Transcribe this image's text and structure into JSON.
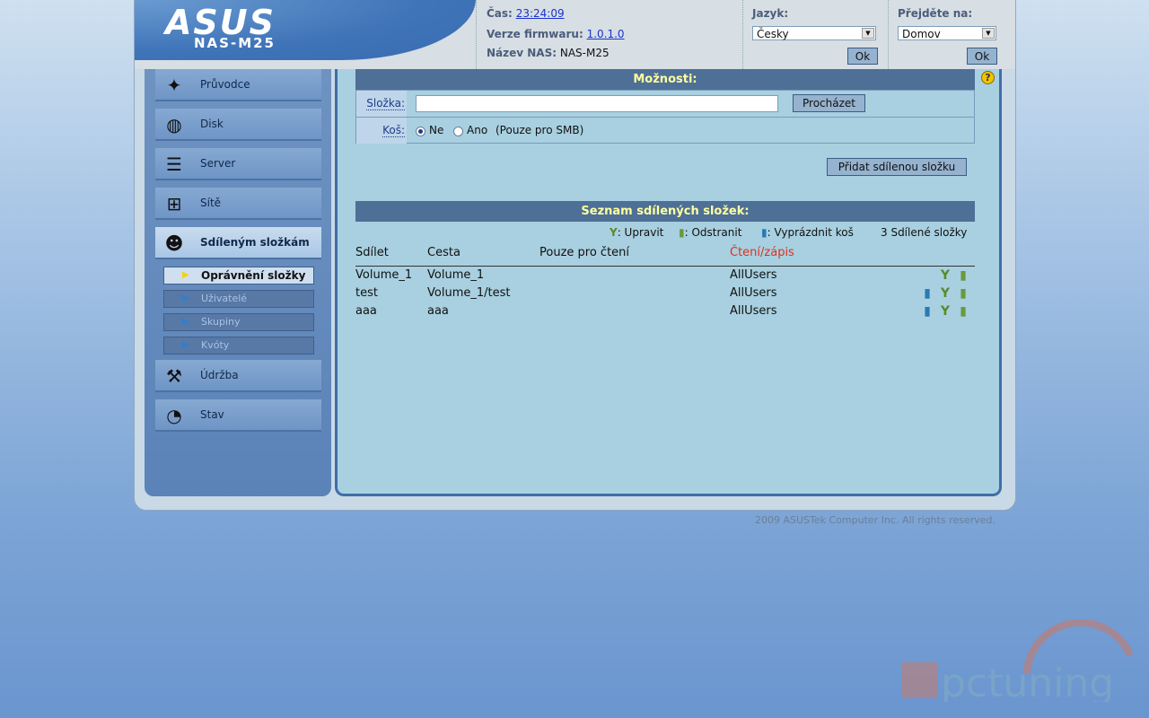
{
  "header": {
    "brand": "ASUS",
    "model": "NAS-M25",
    "time_label": "Čas:",
    "time_value": "23:24:09",
    "firmware_label": "Verze firmwaru:",
    "firmware_value": "1.0.1.0",
    "nasname_label": "Název NAS:",
    "nasname_value": "NAS-M25",
    "language_label": "Jazyk:",
    "language_value": "Česky",
    "goto_label": "Přejděte na:",
    "goto_value": "Domov",
    "ok_label": "Ok"
  },
  "sidebar": {
    "items": [
      {
        "label": "Průvodce",
        "icon": "wand-icon"
      },
      {
        "label": "Disk",
        "icon": "disk-icon"
      },
      {
        "label": "Server",
        "icon": "server-icon"
      },
      {
        "label": "Sítě",
        "icon": "network-icon"
      },
      {
        "label": "Sdíleným složkám",
        "icon": "users-icon"
      },
      {
        "label": "Údržba",
        "icon": "tools-icon"
      },
      {
        "label": "Stav",
        "icon": "status-pie-icon"
      }
    ],
    "subitems": [
      {
        "label": "Oprávnění složky"
      },
      {
        "label": "Uživatelé"
      },
      {
        "label": "Skupiny"
      },
      {
        "label": "Kvóty"
      }
    ]
  },
  "options": {
    "title": "Možnosti:",
    "folder_label": "Složka:",
    "folder_value": "",
    "browse_label": "Procházet",
    "trash_label": "Koš:",
    "trash_no": "Ne",
    "trash_yes": "Ano",
    "trash_note": "(Pouze pro SMB)",
    "trash_selected": "Ne",
    "add_share_label": "Přidat sdílenou složku"
  },
  "shares": {
    "title": "Seznam sdílených složek:",
    "legend_edit": ": Upravit",
    "legend_delete": ": Odstranit",
    "legend_empty": ": Vyprázdnit koš",
    "count_label": "3 Sdílené složky",
    "columns": [
      "Sdílet",
      "Cesta",
      "Pouze pro čtení",
      "Čtení/zápis"
    ],
    "rows": [
      {
        "share": "Volume_1",
        "path": "Volume_1",
        "readonly": "",
        "readwrite": "AllUsers",
        "can_empty": false
      },
      {
        "share": "test",
        "path": "Volume_1/test",
        "readonly": "",
        "readwrite": "AllUsers",
        "can_empty": true
      },
      {
        "share": "aaa",
        "path": "aaa",
        "readonly": "",
        "readwrite": "AllUsers",
        "can_empty": true
      }
    ]
  },
  "footer": {
    "copyright": "2009 ASUSTek Computer Inc. All rights reserved."
  },
  "watermark": {
    "text": "pctuning"
  },
  "colors": {
    "accent": "#4e6f96",
    "header_text": "#ffff9f",
    "rw_header": "#e03020"
  }
}
